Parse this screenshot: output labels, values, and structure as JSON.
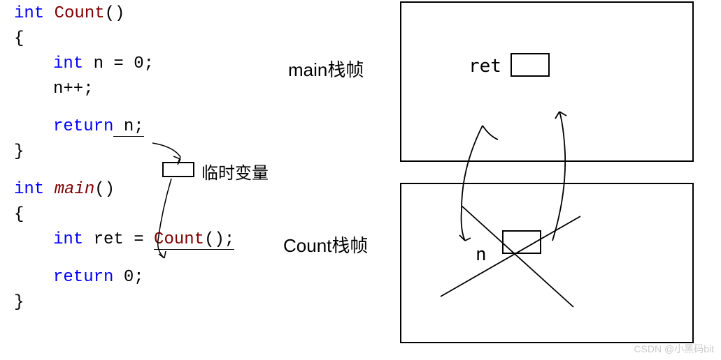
{
  "code": {
    "c_func": {
      "sig_kw": "int",
      "sig_name": "Count",
      "sig_paren": "()",
      "open": "{",
      "l1_kw": "int",
      "l1_rest": " n = 0;",
      "l2": "n++;",
      "l3_kw": "return",
      "l3_rest": " n;",
      "close": "}"
    },
    "main": {
      "sig_kw": "int",
      "sig_name": "main",
      "sig_paren": "()",
      "open": "{",
      "l1_kw": "int",
      "l1_mid": " ret = ",
      "l1_call": "Count",
      "l1_end": "();",
      "l2_kw": "return",
      "l2_rest": " 0;",
      "close": "}"
    }
  },
  "labels": {
    "temp_var": "临时变量",
    "main_frame": "main栈帧",
    "count_frame": "Count栈帧",
    "ret": "ret",
    "n": "n"
  },
  "watermark": "CSDN @小黑码bit"
}
